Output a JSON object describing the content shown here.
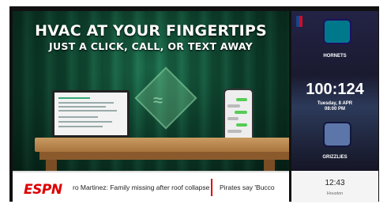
{
  "ad": {
    "headline": "HVAC AT YOUR FINGERTIPS",
    "subheadline": "JUST A CLICK, CALL, OR TEXT AWAY"
  },
  "ticker": {
    "brand": "ESPN",
    "stories": [
      "ro Martinez: Family missing after roof collapse",
      "Pirates say 'Bucco"
    ]
  },
  "game": {
    "home_team": "HORNETS",
    "away_team": "GRIZZLIES",
    "score": "100:124",
    "date": "Tuesday, 8 APR",
    "time": "08:00 PM"
  },
  "clock": {
    "time": "12:43",
    "location": "Houston"
  },
  "colors": {
    "ad_green": "#0f4a33",
    "espn_red": "#dd0000",
    "hornets_teal": "#00788c",
    "grizzlies_navy": "#5d76a9"
  }
}
